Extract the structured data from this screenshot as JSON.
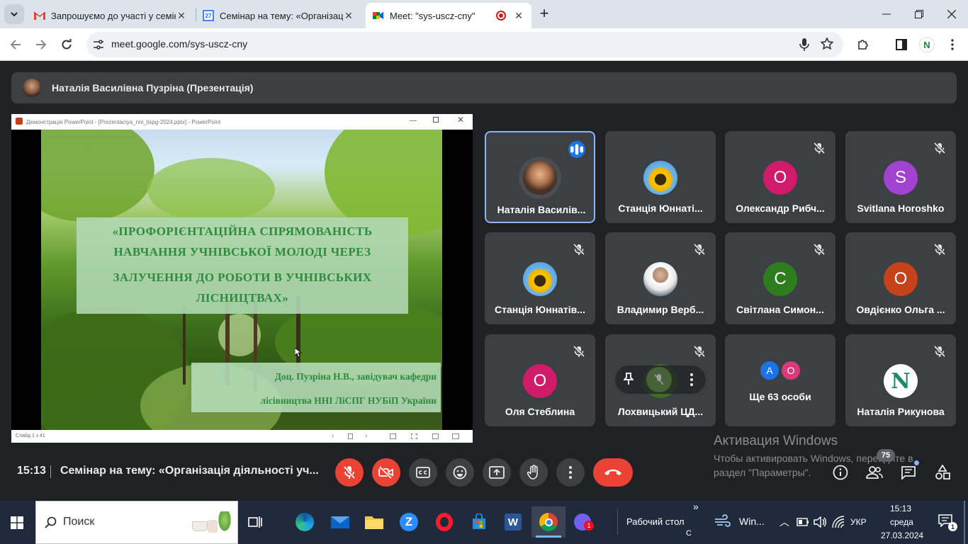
{
  "browser": {
    "tabs": [
      {
        "title": "Запрошуємо до участі у семін",
        "favicon": "gmail-icon"
      },
      {
        "title": "Семінар на тему: «Організаці",
        "favicon": "calendar-icon",
        "favicon_text": "27"
      },
      {
        "title": "Meet: \"sys-uscz-cny\"",
        "favicon": "meet-icon",
        "active": true
      }
    ],
    "url": "meet.google.com/sys-uscz-cny",
    "profile_initial": "N"
  },
  "meet": {
    "presenter_bar": {
      "name": "Наталія Василівна Пузріна (Презентація)"
    },
    "powerpoint": {
      "window_title": "Демонстрація PowerPoint - [Prezentaciya_nni_lispg-2024.pptx] - PowerPoint",
      "slide_status": "Слайд 1 з 41",
      "slide": {
        "title_lines": [
          "«ПРОФОРІЄНТАЦІЙНА СПРЯМОВАНІСТЬ",
          "НАВЧАННЯ УЧНІВСЬКОЇ МОЛОДІ ЧЕРЕЗ",
          "ЗАЛУЧЕННЯ ДО РОБОТИ В УЧНІВСЬКИХ",
          "ЛІСНИЦТВАХ»"
        ],
        "author_lines": [
          "Доц. Пузріна Н.В., завідувач кафедри",
          "лісівництва ННІ ЛіСПГ НУБіП України"
        ]
      }
    },
    "participants": [
      {
        "name": "Наталія Василів...",
        "avatar": "photo",
        "speaking": true
      },
      {
        "name": "Станція Юннаті...",
        "avatar": "sunflower",
        "muted": false
      },
      {
        "name": "Олександр Рибч...",
        "initial": "О",
        "color": "#d01a6a",
        "muted": true
      },
      {
        "name": "Svitlana Horoshko",
        "initial": "S",
        "color": "#a142d0",
        "muted": true
      },
      {
        "name": "Станція Юннатів...",
        "avatar": "sunflower",
        "muted": true
      },
      {
        "name": "Владимир Верб...",
        "avatar": "photo",
        "muted": true
      },
      {
        "name": "Світлана Симон...",
        "initial": "С",
        "color": "#2d7d1f",
        "muted": true
      },
      {
        "name": "Овдієнко Ольга ...",
        "initial": "О",
        "color": "#c5421a",
        "muted": true
      },
      {
        "name": "Оля Стеблина",
        "initial": "О",
        "color": "#d01a6a",
        "muted": true
      },
      {
        "name": "Лохвицький ЦД...",
        "avatar": "photo",
        "muted": true
      },
      {
        "name": "Ще 63 особи",
        "more_initials": [
          "А",
          "О"
        ]
      },
      {
        "name": "Наталія Рикунова",
        "avatar": "logo-n",
        "muted": true
      }
    ],
    "bottom": {
      "time": "15:13",
      "meeting_title": "Семінар на тему: «Організація діяльності уч...",
      "participant_count": "75"
    },
    "activate_windows": {
      "title": "Активация Windows",
      "line": "Чтобы активировать Windows, перейдите в раздел \"Параметры\"."
    }
  },
  "taskbar": {
    "search_placeholder": "Поиск",
    "desktop_label": "Рабочий стол",
    "desktop_sub": "С",
    "weather_label": "Win...",
    "language": "УКР",
    "time": "15:13",
    "weekday": "среда",
    "date": "27.03.2024",
    "notifications": "1"
  }
}
